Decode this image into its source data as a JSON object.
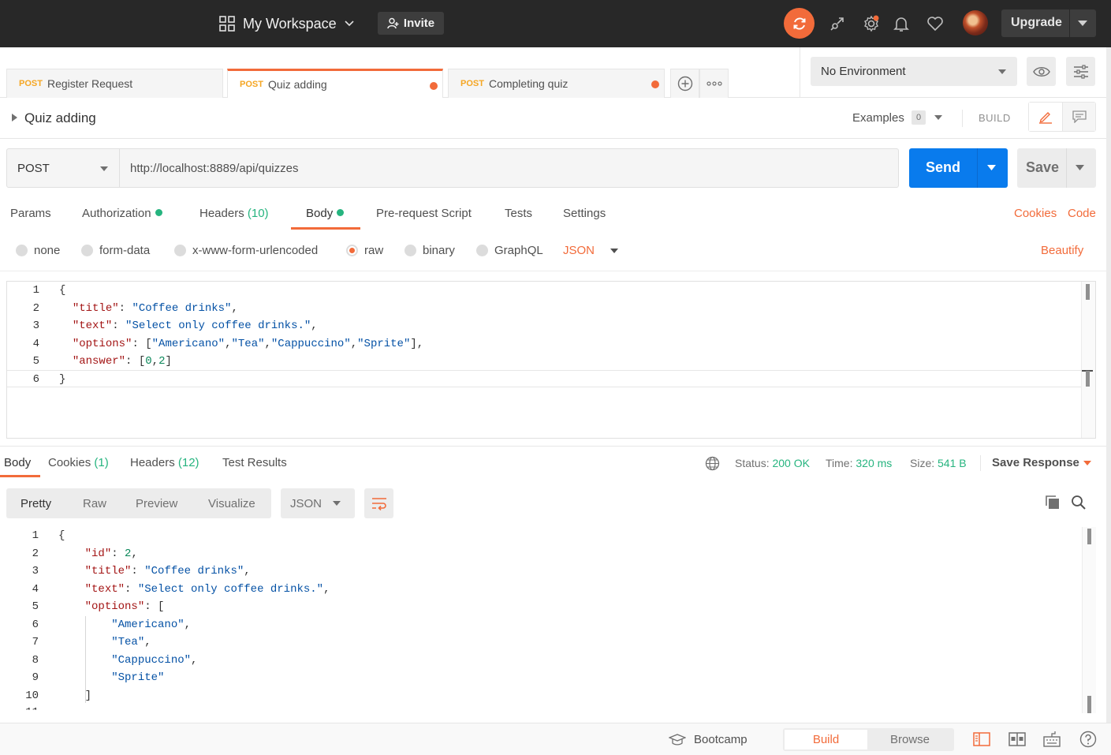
{
  "topbar": {
    "workspace": "My Workspace",
    "invite": "Invite",
    "upgrade": "Upgrade",
    "accent": "#f26b3a"
  },
  "tabs": [
    {
      "method": "POST",
      "name": "Register Request",
      "unsaved": false,
      "active": false
    },
    {
      "method": "POST",
      "name": "Quiz adding",
      "unsaved": true,
      "active": true
    },
    {
      "method": "POST",
      "name": "Completing quiz",
      "unsaved": true,
      "active": false
    }
  ],
  "environment": {
    "selected": "No Environment"
  },
  "request": {
    "name": "Quiz adding",
    "examples_label": "Examples",
    "examples_count": "0",
    "build_label": "BUILD",
    "method": "POST",
    "url": "http://localhost:8889/api/quizzes",
    "send": "Send",
    "save": "Save"
  },
  "request_tabs": {
    "params": "Params",
    "authorization": "Authorization",
    "headers": "Headers",
    "headers_count": "(10)",
    "body": "Body",
    "prerequest": "Pre-request Script",
    "tests": "Tests",
    "settings": "Settings",
    "cookies": "Cookies",
    "code": "Code"
  },
  "body_types": {
    "none": "none",
    "form_data": "form-data",
    "urlencoded": "x-www-form-urlencoded",
    "raw": "raw",
    "binary": "binary",
    "graphql": "GraphQL",
    "format": "JSON",
    "beautify": "Beautify",
    "selected": "raw"
  },
  "request_body_lines": [
    "{",
    "  \"title\": \"Coffee drinks\",",
    "  \"text\": \"Select only coffee drinks.\",",
    "  \"options\": [\"Americano\",\"Tea\",\"Cappuccino\",\"Sprite\"],",
    "  \"answer\": [0,2]",
    "}"
  ],
  "response_tabs": {
    "body": "Body",
    "cookies": "Cookies",
    "cookies_count": "(1)",
    "headers": "Headers",
    "headers_count": "(12)",
    "test_results": "Test Results"
  },
  "response_status": {
    "status_label": "Status:",
    "status": "200 OK",
    "time_label": "Time:",
    "time": "320 ms",
    "size_label": "Size:",
    "size": "541 B",
    "save_response": "Save Response"
  },
  "response_views": {
    "pretty": "Pretty",
    "raw": "Raw",
    "preview": "Preview",
    "visualize": "Visualize",
    "format": "JSON"
  },
  "response_body_lines": [
    "{",
    "    \"id\": 2,",
    "    \"title\": \"Coffee drinks\",",
    "    \"text\": \"Select only coffee drinks.\",",
    "    \"options\": [",
    "        \"Americano\",",
    "        \"Tea\",",
    "        \"Cappuccino\",",
    "        \"Sprite\"",
    "    ]"
  ],
  "footer": {
    "bootcamp": "Bootcamp",
    "build": "Build",
    "browse": "Browse"
  }
}
